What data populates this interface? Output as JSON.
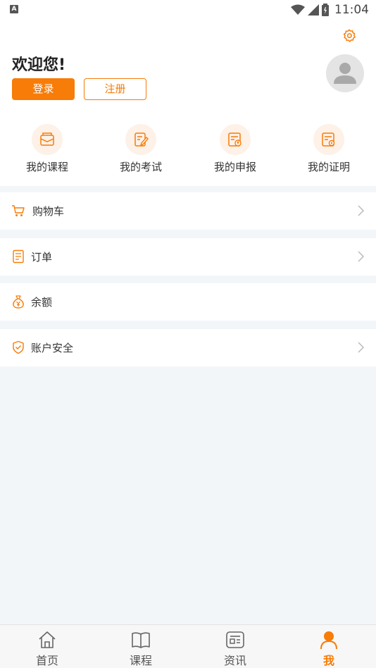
{
  "status_bar": {
    "time": "11:04",
    "notification_icon": "A"
  },
  "profile": {
    "welcome": "欢迎您!",
    "login_label": "登录",
    "register_label": "注册"
  },
  "shortcuts": [
    {
      "label": "我的课程",
      "icon": "course-icon"
    },
    {
      "label": "我的考试",
      "icon": "exam-icon"
    },
    {
      "label": "我的申报",
      "icon": "declaration-icon"
    },
    {
      "label": "我的证明",
      "icon": "certificate-icon"
    }
  ],
  "menu": [
    {
      "label": "购物车",
      "icon": "cart-icon",
      "has_chevron": true
    },
    {
      "label": "订单",
      "icon": "order-icon",
      "has_chevron": true
    },
    {
      "label": "余额",
      "icon": "balance-icon",
      "has_chevron": false
    },
    {
      "label": "账户安全",
      "icon": "shield-icon",
      "has_chevron": true
    }
  ],
  "tabs": [
    {
      "label": "首页",
      "icon": "home-icon",
      "active": false
    },
    {
      "label": "课程",
      "icon": "book-icon",
      "active": false
    },
    {
      "label": "资讯",
      "icon": "news-icon",
      "active": false
    },
    {
      "label": "我",
      "icon": "person-icon",
      "active": true
    }
  ],
  "colors": {
    "accent": "#f77c08",
    "background": "#f3f6f9",
    "accent_light": "#fdf1e8"
  }
}
